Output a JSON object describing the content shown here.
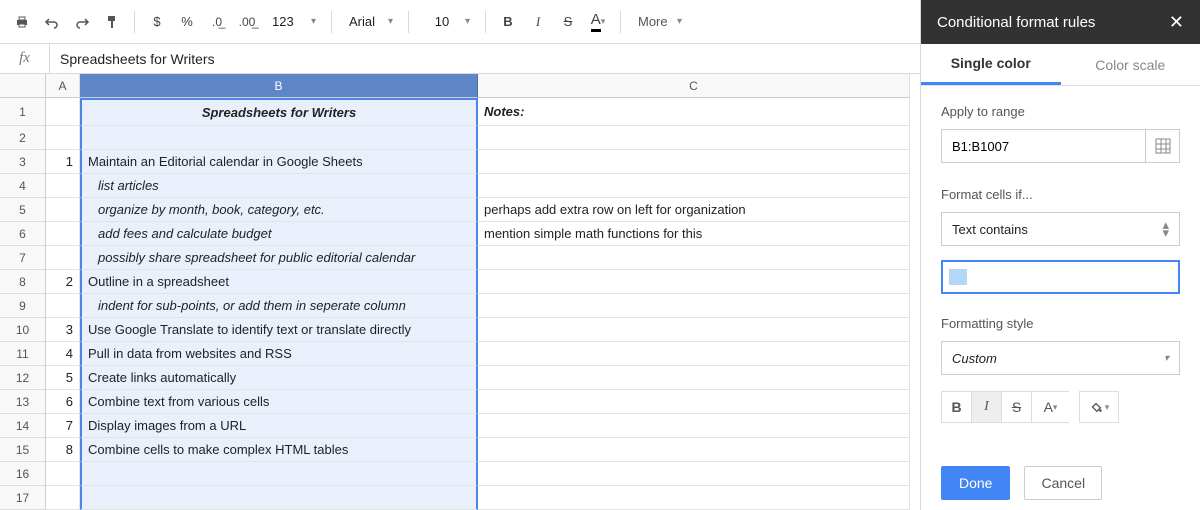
{
  "toolbar": {
    "font_family": "Arial",
    "font_size": "10",
    "more_label": "More",
    "number_format": "123"
  },
  "formula_bar": {
    "fx_label": "fx",
    "value": "Spreadsheets for Writers"
  },
  "columns": [
    "A",
    "B",
    "C"
  ],
  "rows": [
    {
      "n": 1,
      "a": "",
      "b": "Spreadsheets for Writers",
      "c": "Notes:",
      "b_title": true,
      "c_bolditalic": true,
      "tall": true
    },
    {
      "n": 2,
      "a": "",
      "b": "",
      "c": ""
    },
    {
      "n": 3,
      "a": "1",
      "b": "Maintain an Editorial calendar in Google Sheets",
      "c": ""
    },
    {
      "n": 4,
      "a": "",
      "b": "list articles",
      "c": "",
      "b_italic": true,
      "indent": true
    },
    {
      "n": 5,
      "a": "",
      "b": "organize by month, book, category, etc.",
      "c": "perhaps add extra row on left for organization",
      "b_italic": true,
      "indent": true
    },
    {
      "n": 6,
      "a": "",
      "b": "add fees and calculate budget",
      "c": "mention simple math functions for this",
      "b_italic": true,
      "indent": true
    },
    {
      "n": 7,
      "a": "",
      "b": "possibly share spreadsheet for public editorial calendar",
      "c": "",
      "b_italic": true,
      "indent": true
    },
    {
      "n": 8,
      "a": "2",
      "b": "Outline in a spreadsheet",
      "c": ""
    },
    {
      "n": 9,
      "a": "",
      "b": "indent for sub-points, or add them in seperate column",
      "c": "",
      "b_italic": true,
      "indent": true
    },
    {
      "n": 10,
      "a": "3",
      "b": "Use Google Translate to identify text or translate directly",
      "c": ""
    },
    {
      "n": 11,
      "a": "4",
      "b": "Pull in data from websites and RSS",
      "c": ""
    },
    {
      "n": 12,
      "a": "5",
      "b": "Create links automatically",
      "c": ""
    },
    {
      "n": 13,
      "a": "6",
      "b": "Combine text from various cells",
      "c": ""
    },
    {
      "n": 14,
      "a": "7",
      "b": "Display images from a URL",
      "c": ""
    },
    {
      "n": 15,
      "a": "8",
      "b": "Combine cells to make complex HTML tables",
      "c": ""
    },
    {
      "n": 16,
      "a": "",
      "b": "",
      "c": ""
    },
    {
      "n": 17,
      "a": "",
      "b": "",
      "c": ""
    }
  ],
  "panel": {
    "title": "Conditional format rules",
    "tabs": {
      "single": "Single color",
      "scale": "Color scale"
    },
    "apply_label": "Apply to range",
    "range_value": "B1:B1007",
    "format_if_label": "Format cells if...",
    "condition": "Text contains",
    "style_label": "Formatting style",
    "style_value": "Custom",
    "done": "Done",
    "cancel": "Cancel"
  }
}
